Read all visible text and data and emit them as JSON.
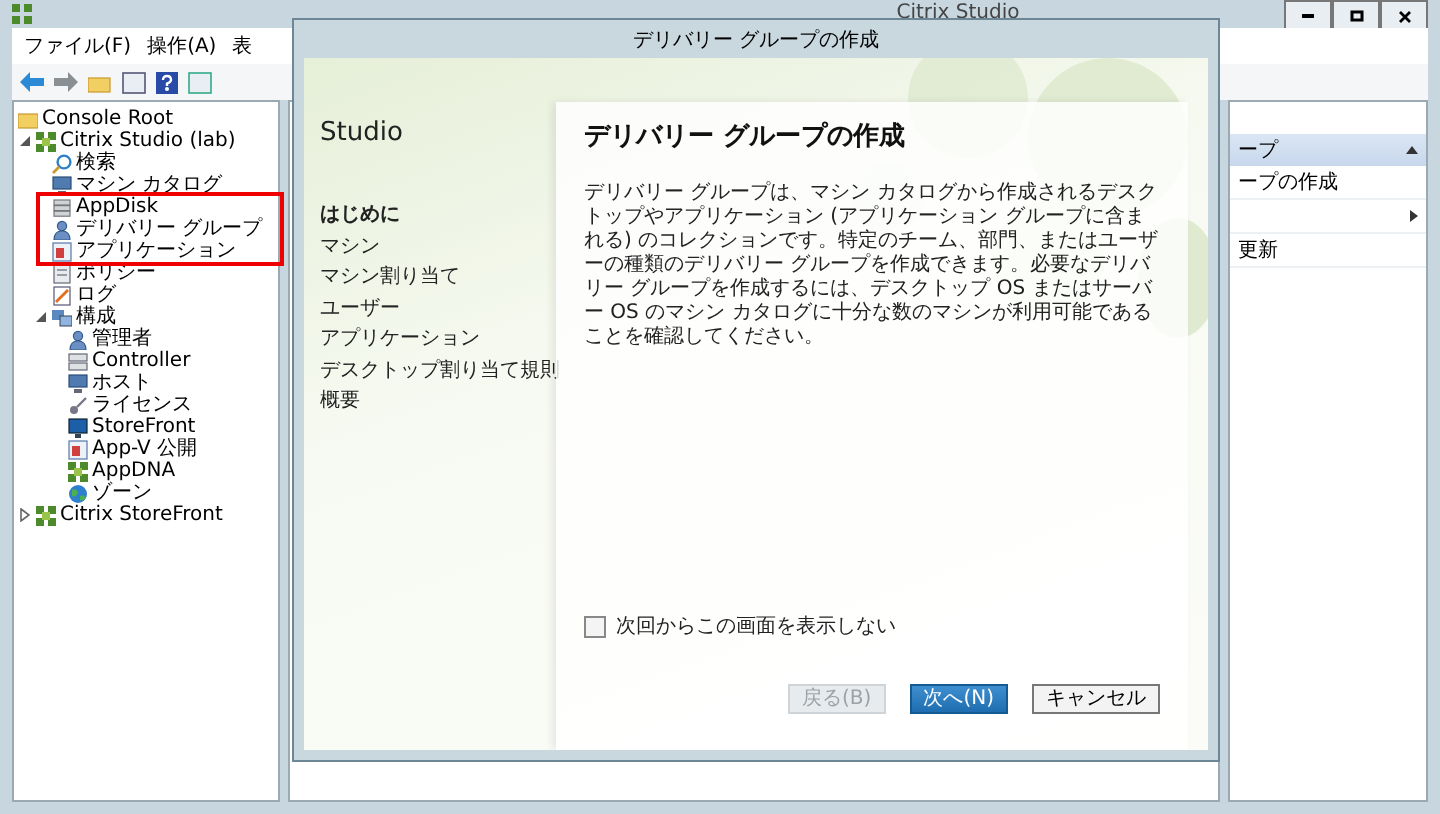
{
  "window": {
    "title": "Citrix Studio"
  },
  "menu": [
    "ファイル(F)",
    "操作(A)",
    "表"
  ],
  "tree": [
    {
      "label": "Console Root",
      "kind": "folder"
    },
    {
      "label": "Citrix Studio (lab)",
      "kind": "grid",
      "expanded": true,
      "children": [
        {
          "label": "検索",
          "kind": "search"
        },
        {
          "label": "マシン カタログ",
          "kind": "monitor"
        },
        {
          "label": "AppDisk",
          "kind": "database"
        },
        {
          "label": "デリバリー グループ",
          "kind": "person"
        },
        {
          "label": "アプリケーション",
          "kind": "app"
        },
        {
          "label": "ポリシー",
          "kind": "document"
        },
        {
          "label": "ログ",
          "kind": "log"
        },
        {
          "label": "構成",
          "kind": "config",
          "expanded": true,
          "children": [
            {
              "label": "管理者",
              "kind": "person"
            },
            {
              "label": "Controller",
              "kind": "server"
            },
            {
              "label": "ホスト",
              "kind": "monitor"
            },
            {
              "label": "ライセンス",
              "kind": "key"
            },
            {
              "label": "StoreFront",
              "kind": "screen"
            },
            {
              "label": "App-V 公開",
              "kind": "app"
            },
            {
              "label": "AppDNA",
              "kind": "grid"
            },
            {
              "label": "ゾーン",
              "kind": "globe"
            }
          ]
        }
      ]
    },
    {
      "label": "Citrix StoreFront",
      "kind": "grid",
      "expanded": false
    }
  ],
  "actions": {
    "header": "ープ",
    "items": [
      {
        "label": "ープの作成",
        "submenu": false
      },
      {
        "submenu": true
      },
      {
        "label": "更新",
        "submenu": false
      }
    ]
  },
  "dialog": {
    "title": "デリバリー グループの作成",
    "brand": "Studio",
    "steps": [
      {
        "label": "はじめに",
        "selected": true
      },
      {
        "label": "マシン",
        "selected": false
      },
      {
        "label": "マシン割り当て",
        "selected": false
      },
      {
        "label": "ユーザー",
        "selected": false
      },
      {
        "label": "アプリケーション",
        "selected": false
      },
      {
        "label": "デスクトップ割り当て規則",
        "selected": false
      },
      {
        "label": "概要",
        "selected": false
      }
    ],
    "heading": "デリバリー グループの作成",
    "description": "デリバリー グループは、マシン カタログから作成されるデスクトップやアプリケーション (アプリケーション グループに含まれる) のコレクションです。特定のチーム、部門、またはユーザーの種類のデリバリー グループを作成できます。必要なデリバリー グループを作成するには、デスクトップ OS またはサーバー OS のマシン カタログに十分な数のマシンが利用可能であることを確認してください。",
    "checkbox": {
      "label": "次回からこの画面を表示しない",
      "checked": false
    },
    "buttons": [
      {
        "label": "戻る(B)",
        "kind": "disabled"
      },
      {
        "label": "次へ(N)",
        "kind": "primary"
      },
      {
        "label": "キャンセル",
        "kind": "normal"
      }
    ]
  }
}
